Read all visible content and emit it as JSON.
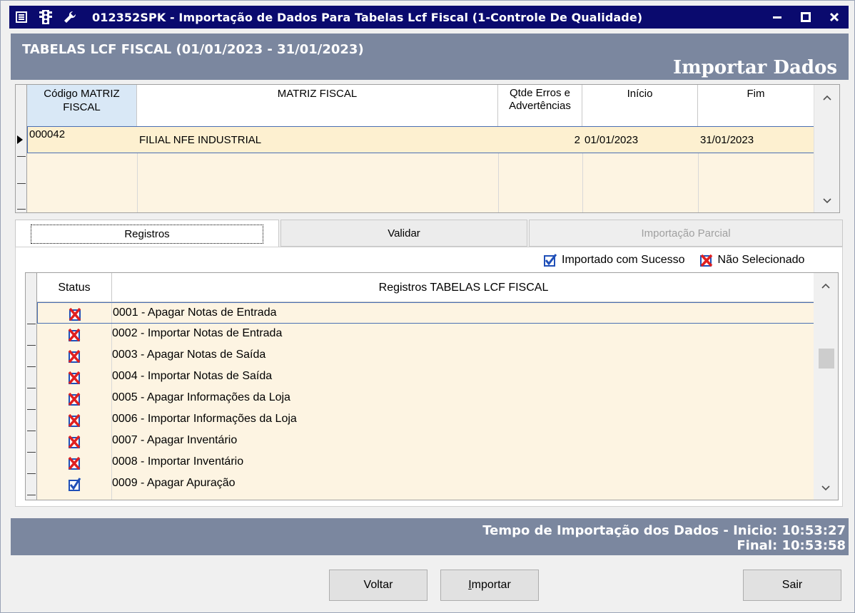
{
  "window": {
    "title": "012352SPK - Importação de Dados Para Tabelas Lcf Fiscal (1-Controle De Qualidade)",
    "controls": [
      "minimize",
      "maximize",
      "close"
    ]
  },
  "header": {
    "title": "TABELAS LCF FISCAL (01/01/2023 - 31/01/2023)",
    "action": "Importar Dados"
  },
  "matrix_grid": {
    "columns": {
      "codigo": "Código MATRIZ FISCAL",
      "matriz": "MATRIZ FISCAL",
      "qtde": "Qtde Erros e Advertências",
      "inicio": "Início",
      "fim": "Fim"
    },
    "rows": [
      {
        "codigo": "000042",
        "matriz": "FILIAL NFE INDUSTRIAL",
        "qtde": "2",
        "inicio": "01/01/2023",
        "fim": "31/01/2023"
      }
    ]
  },
  "tabs": [
    {
      "label": "Registros",
      "state": "active"
    },
    {
      "label": "Validar",
      "state": "normal"
    },
    {
      "label": "Importação Parcial",
      "state": "disabled"
    }
  ],
  "legend": {
    "success": "Importado com Sucesso",
    "not_selected": "Não Selecionado"
  },
  "records_grid": {
    "columns": {
      "status": "Status",
      "registro": "Registros TABELAS LCF FISCAL"
    },
    "rows": [
      {
        "label": "0001 - Apagar Notas de Entrada",
        "status": "not-selected"
      },
      {
        "label": "0002 - Importar Notas de Entrada",
        "status": "not-selected"
      },
      {
        "label": "0003 - Apagar Notas de Saída",
        "status": "not-selected"
      },
      {
        "label": "0004 - Importar Notas de Saída",
        "status": "not-selected"
      },
      {
        "label": "0005 - Apagar Informações da Loja",
        "status": "not-selected"
      },
      {
        "label": "0006 - Importar Informações da Loja",
        "status": "not-selected"
      },
      {
        "label": "0007 - Apagar Inventário",
        "status": "not-selected"
      },
      {
        "label": "0008 - Importar Inventário",
        "status": "not-selected"
      },
      {
        "label": "0009 - Apagar Apuração",
        "status": "success"
      }
    ]
  },
  "footer": {
    "line1": "Tempo de Importação dos Dados - Inicio: 10:53:27",
    "line2": "Final: 10:53:58"
  },
  "buttons": {
    "voltar": "Voltar",
    "importar": "Importar",
    "sair": "Sair"
  },
  "colors": {
    "titlebar": "#0a0a6e",
    "band": "#7b879f",
    "selected_row": "#fdf0d0",
    "grid_body": "#fdf4e2",
    "selection_border": "#4a6fb3"
  }
}
